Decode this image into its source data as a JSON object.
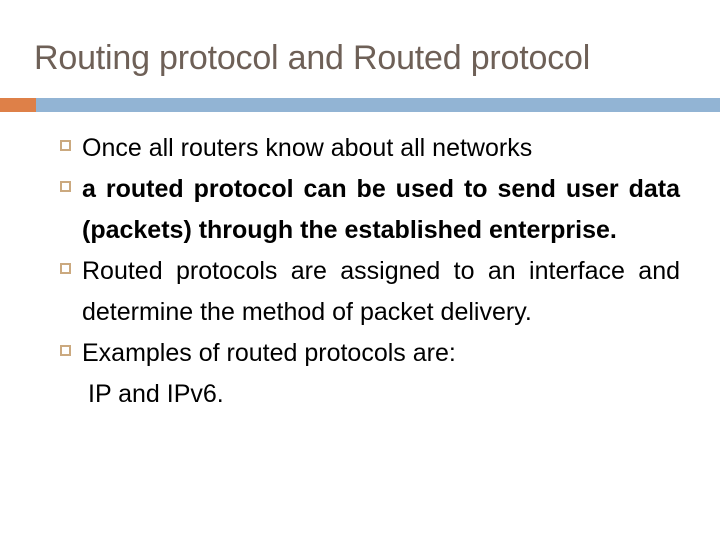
{
  "slide": {
    "title": "Routing protocol and Routed protocol",
    "title_color": "#6e6057",
    "accent_orange": "#de8048",
    "accent_blue": "#92b4d4",
    "bullet_marker_color": "#cba97f",
    "body_text_color": "#000000",
    "background": "#ffffff"
  },
  "bullets": [
    {
      "marker": "hollow-square-bullet",
      "text": "Once all routers know about all networks",
      "bold": false,
      "justified": false
    },
    {
      "marker": "hollow-square-bullet",
      "text": "a routed protocol can be used to send user data (packets) through the established enterprise.",
      "bold": true,
      "justified": true
    },
    {
      "marker": "hollow-square-bullet",
      "text": "Routed protocols are assigned to an interface and determine the method of packet delivery.",
      "bold": false,
      "justified": true
    },
    {
      "marker": "hollow-square-bullet",
      "text": " Examples of routed protocols are:",
      "sub_text": "IP and IPv6.",
      "bold": false,
      "justified": false
    }
  ]
}
